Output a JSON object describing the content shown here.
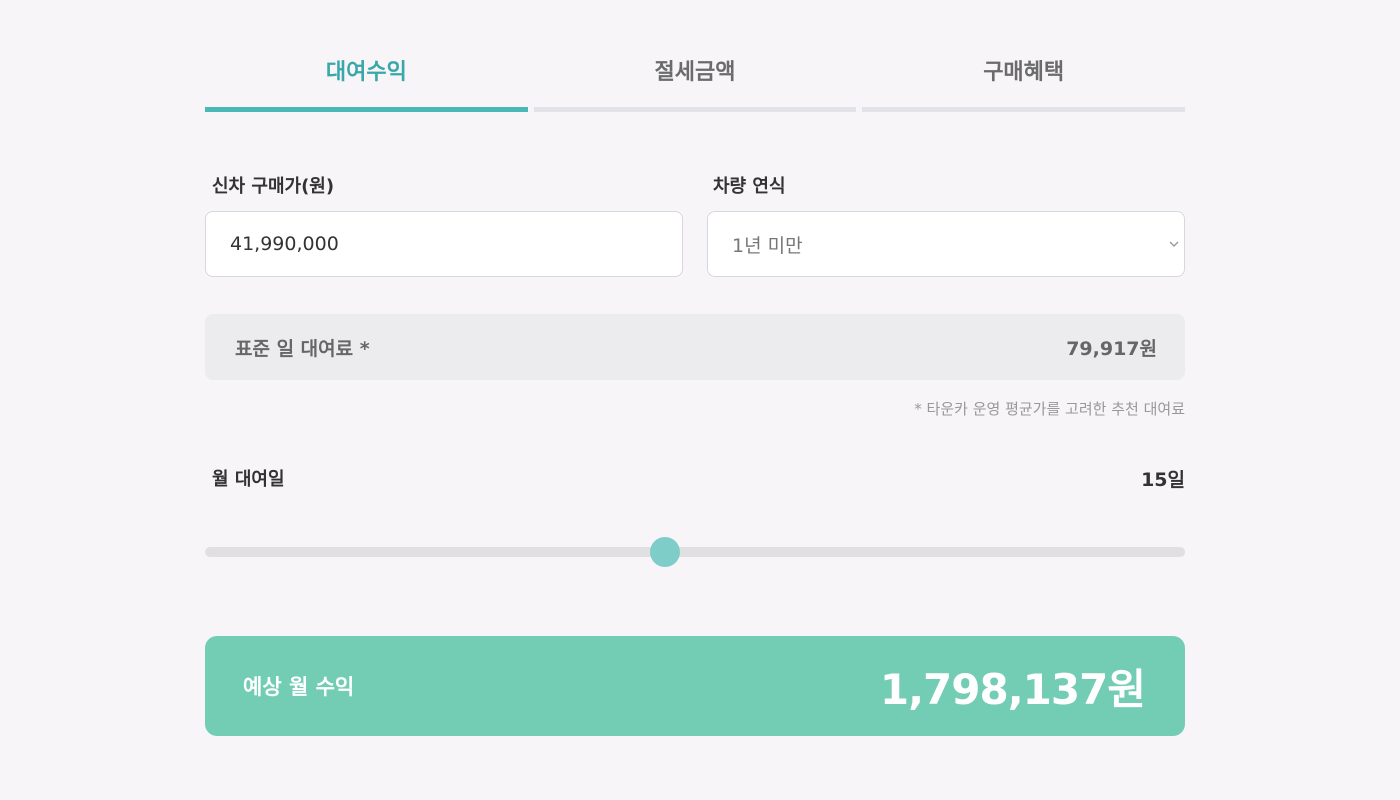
{
  "tabs": [
    {
      "label": "대여수익",
      "active": true
    },
    {
      "label": "절세금액",
      "active": false
    },
    {
      "label": "구매혜택",
      "active": false
    }
  ],
  "purchase_price": {
    "label": "신차 구매가(원)",
    "value": "41,990,000"
  },
  "vehicle_year": {
    "label": "차량 연식",
    "selected": "1년 미만"
  },
  "standard_fee": {
    "label": "표준 일 대여료 *",
    "value": "79,917원"
  },
  "note": "* 타운카 운영 평균가를 고려한 추천 대여료",
  "monthly_days": {
    "label": "월 대여일",
    "value_text": "15일",
    "slider_fraction": 0.469
  },
  "result": {
    "label": "예상 월 수익",
    "value": "1,798,137원"
  },
  "colors": {
    "accent": "#4ab8b4",
    "active_tab_text": "#3aa8a8",
    "result_bg": "#72cdb4",
    "slider_thumb": "#7ecdc9",
    "background": "#f7f5f8"
  }
}
